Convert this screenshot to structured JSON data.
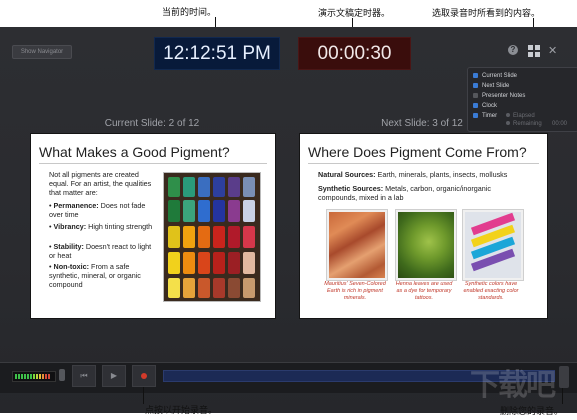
{
  "annotations": {
    "clock": "当前的时间。",
    "timer": "演示文稿定时器。",
    "options": "选取录音时所看到的内容。",
    "record": "点按以开始录音。",
    "delete": "删除您的录音。"
  },
  "toolbar": {
    "show_navigator": "Show Navigator",
    "clock_time": "12:12:51 PM",
    "timer_time": "00:00:30",
    "help_icon": "?",
    "close_icon": "✕"
  },
  "options_popover": {
    "items": [
      {
        "label": "Current Slide",
        "checked": true
      },
      {
        "label": "Next Slide",
        "checked": true
      },
      {
        "label": "Presenter Notes",
        "checked": false
      },
      {
        "label": "Clock",
        "checked": true
      },
      {
        "label": "Timer",
        "checked": true
      }
    ],
    "timer_modes": [
      "Elapsed",
      "Remaining"
    ],
    "remaining_value": "00:00"
  },
  "current_slide": {
    "label": "Current Slide: 2 of 12",
    "title": "What Makes a Good Pigment?",
    "intro": "Not all pigments are created equal. For an artist, the qualities that matter are:",
    "bullets": [
      {
        "term": "Permanence:",
        "text": " Does not fade over time"
      },
      {
        "term": "Vibrancy:",
        "text": " High tinting strength"
      },
      {
        "term": "Stability:",
        "text": " Doesn't react to light or heat"
      },
      {
        "term": "Non-toxic:",
        "text": " From a safe synthetic, mineral, or organic compound"
      }
    ]
  },
  "next_slide": {
    "label": "Next Slide: 3 of 12",
    "title": "Where Does Pigment Come From?",
    "natural_term": "Natural Sources:",
    "natural_text": " Earth, minerals, plants, insects, mollusks",
    "synthetic_term": "Synthetic Sources:",
    "synthetic_text": " Metals, carbon, organic/inorganic compounds, mixed in a lab",
    "captions": [
      "Mauritius' Seven-Colored Earth is rich in pigment minerals.",
      "Henna leaves are used as a dye for temporary tattoos.",
      "Synthetic colors have enabled exacting color standards."
    ]
  },
  "watermark": "下载吧"
}
